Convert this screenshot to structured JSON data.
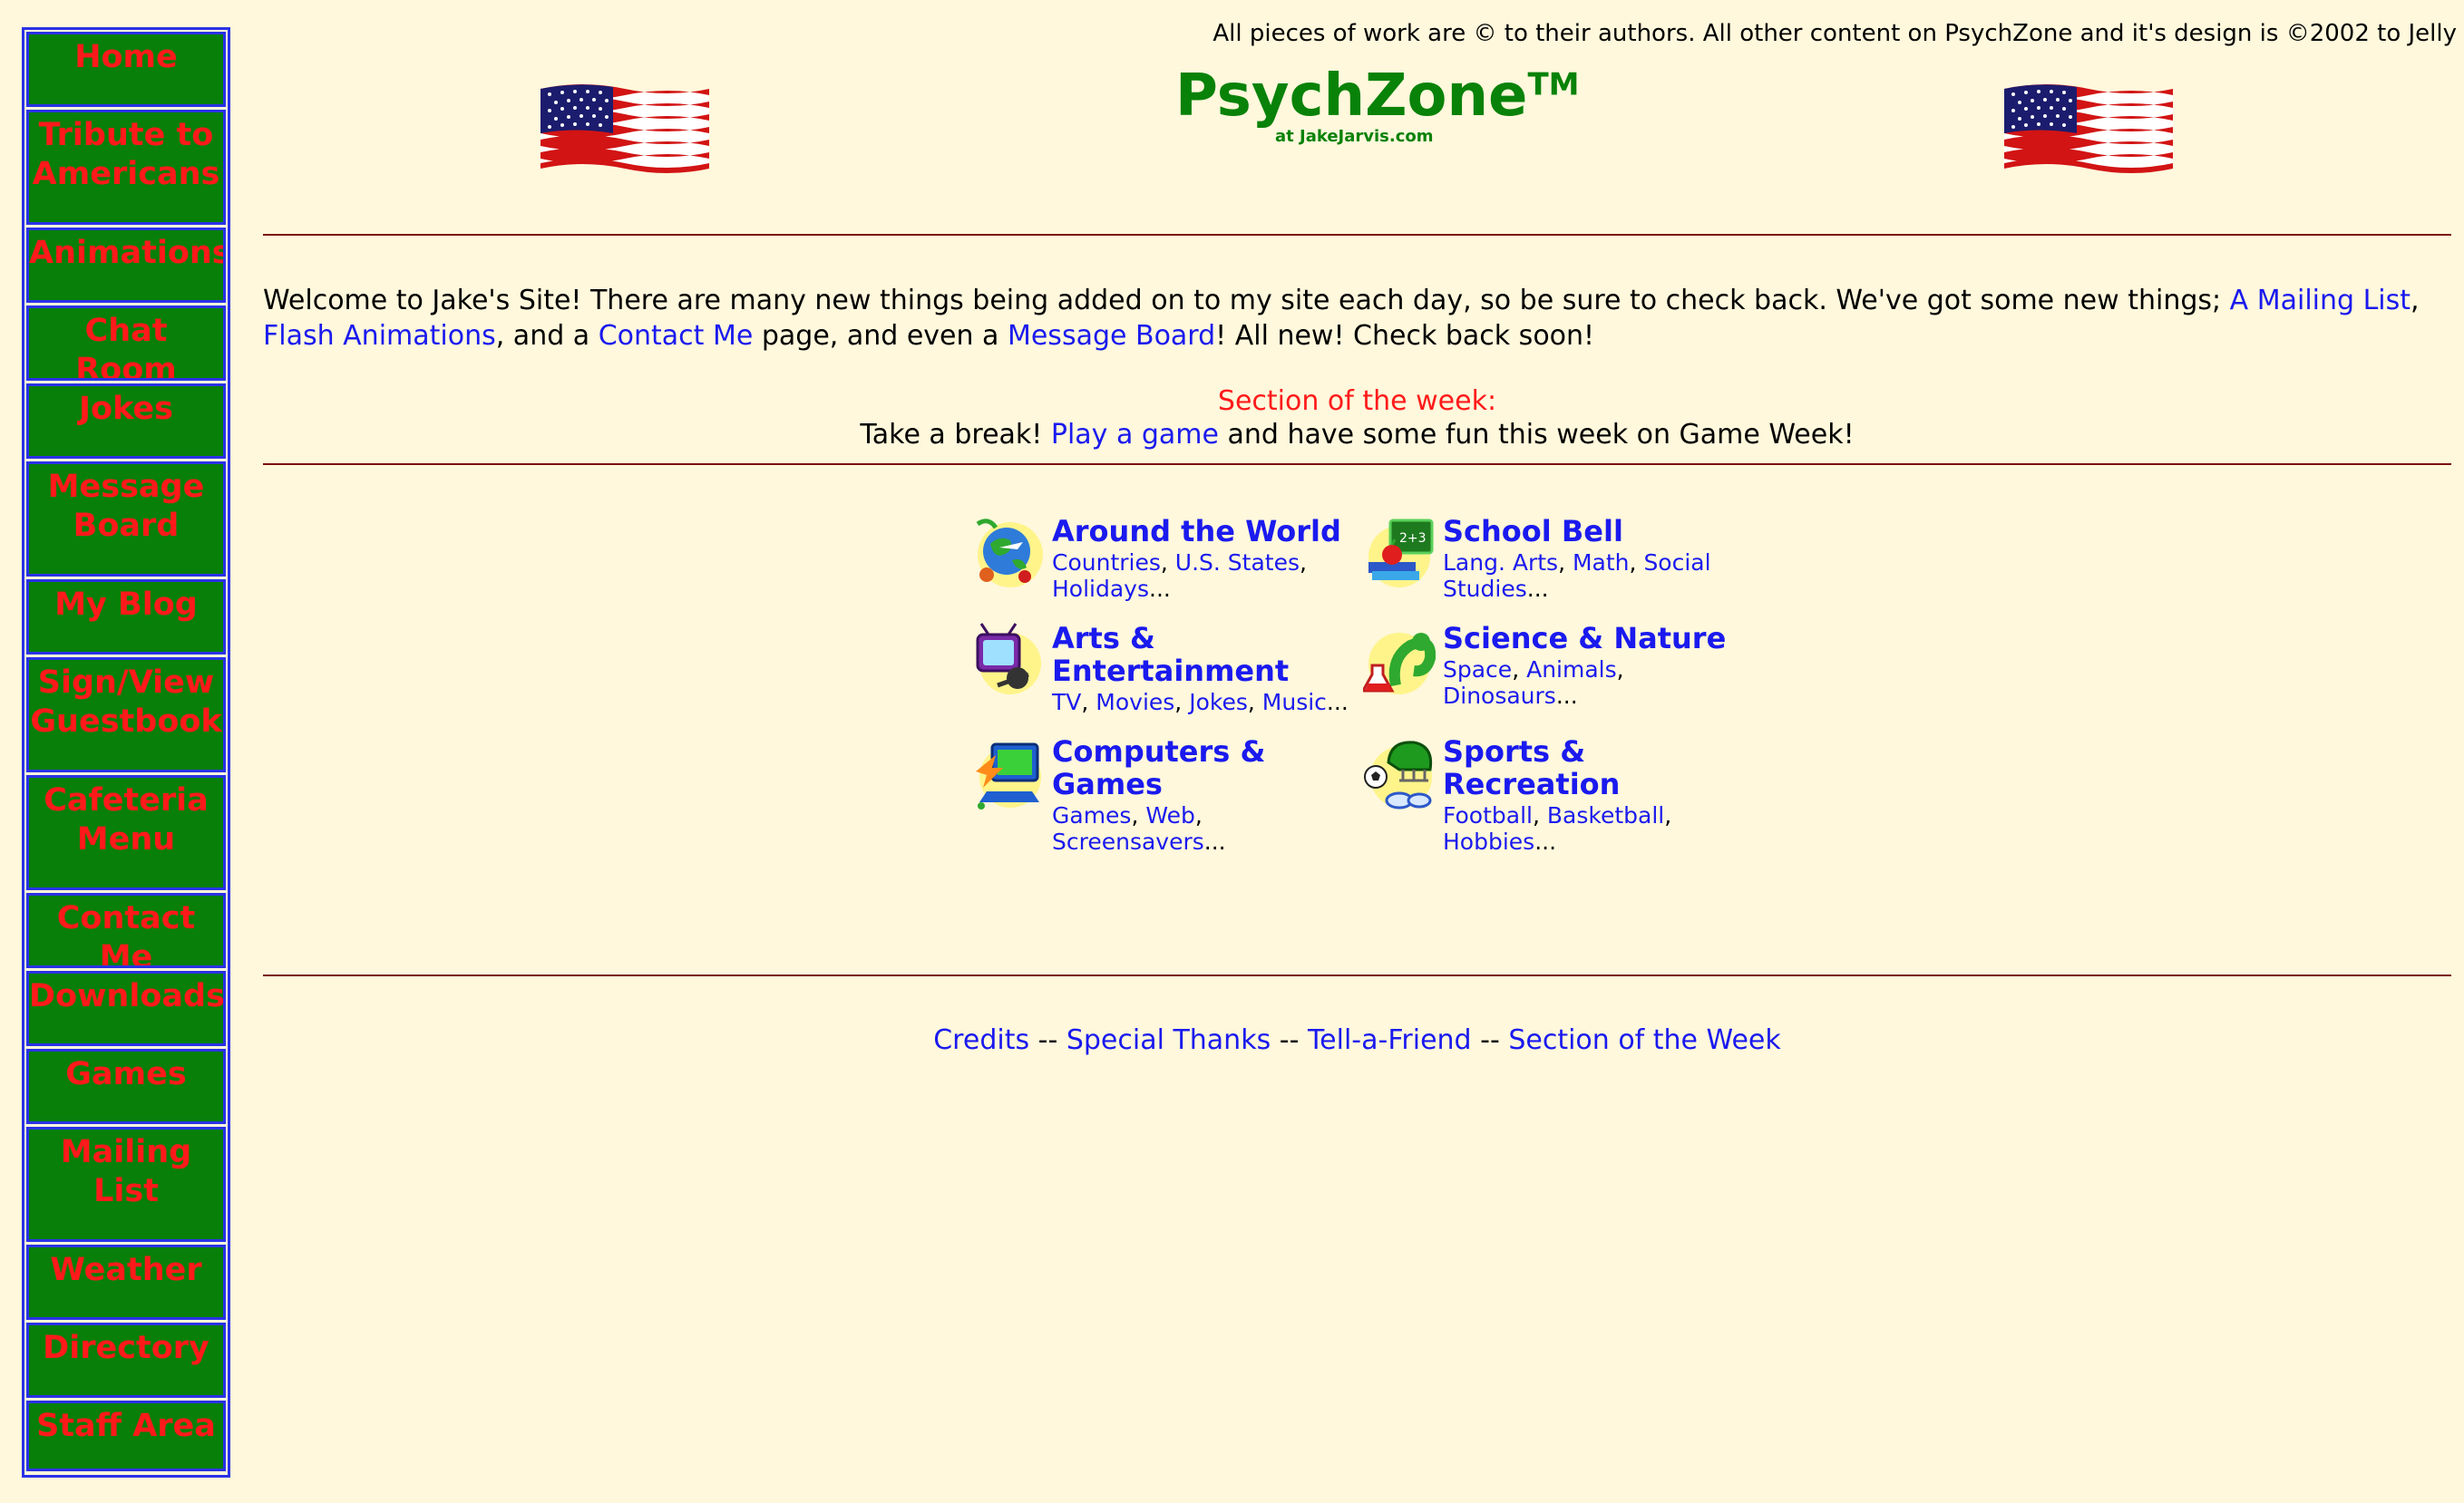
{
  "sidebar": {
    "items": [
      {
        "label": "Home"
      },
      {
        "label": "Tribute to Americans"
      },
      {
        "label": "Animations"
      },
      {
        "label": "Chat Room"
      },
      {
        "label": "Jokes"
      },
      {
        "label": "Message Board"
      },
      {
        "label": "My Blog"
      },
      {
        "label": "Sign/View Guestbook"
      },
      {
        "label": "Cafeteria Menu"
      },
      {
        "label": "Contact Me"
      },
      {
        "label": "Downloads"
      },
      {
        "label": "Games"
      },
      {
        "label": "Mailing List"
      },
      {
        "label": "Weather"
      },
      {
        "label": "Directory"
      },
      {
        "label": "Staff Area"
      }
    ]
  },
  "header": {
    "copyright": "All pieces of work are © to their authors. All other content on PsychZone and it's design is ©2002 to Jelly",
    "title": "PsychZone",
    "trademark": "TM",
    "subtitle": "at JakeJarvis.com",
    "flag_icon": "us-flag-icon"
  },
  "welcome": {
    "text_1": "Welcome to Jake's Site! There are many new things being added on to my site each day, so be sure to check back. We've got some new things; ",
    "link_mailing_list": "A Mailing List",
    "text_2": ",",
    "link_flash": "Flash Animations",
    "text_3": ", and a ",
    "link_contact": "Contact Me",
    "text_4": " page, and even a ",
    "link_message_board": "Message Board",
    "text_5": "! All new! Check back soon!"
  },
  "section_of_week": {
    "heading": "Section of the week:",
    "text_1": "Take a break! ",
    "link": "Play a game",
    "text_2": " and have some fun this week on Game Week!"
  },
  "categories": [
    {
      "title": "Around the World",
      "icon": "globe-icon",
      "links": [
        "Countries",
        "U.S. States",
        "Holidays"
      ]
    },
    {
      "title": "School Bell",
      "icon": "school-books-icon",
      "links": [
        "Lang. Arts",
        "Math",
        "Social Studies"
      ]
    },
    {
      "title": "Arts & Entertainment",
      "icon": "tv-icon",
      "links": [
        "TV",
        "Movies",
        "Jokes",
        "Music"
      ]
    },
    {
      "title": "Science & Nature",
      "icon": "science-icon",
      "links": [
        "Space",
        "Animals",
        "Dinosaurs"
      ]
    },
    {
      "title": "Computers & Games",
      "icon": "computer-icon",
      "links": [
        "Games",
        "Web",
        "Screensavers"
      ]
    },
    {
      "title": "Sports & Recreation",
      "icon": "sports-icon",
      "links": [
        "Football",
        "Basketball",
        "Hobbies"
      ]
    }
  ],
  "footer": {
    "links": [
      "Credits",
      "Special Thanks",
      "Tell-a-Friend",
      "Section of the Week"
    ],
    "separator": " -- "
  },
  "colors": {
    "background": "#fff8dc",
    "nav_green": "#087f08",
    "nav_red_text": "#ff1a1a",
    "nav_border_blue": "#2a32e6",
    "brand_green": "#098209",
    "link_blue": "#1a1aee",
    "rule_maroon": "#7a1010"
  }
}
